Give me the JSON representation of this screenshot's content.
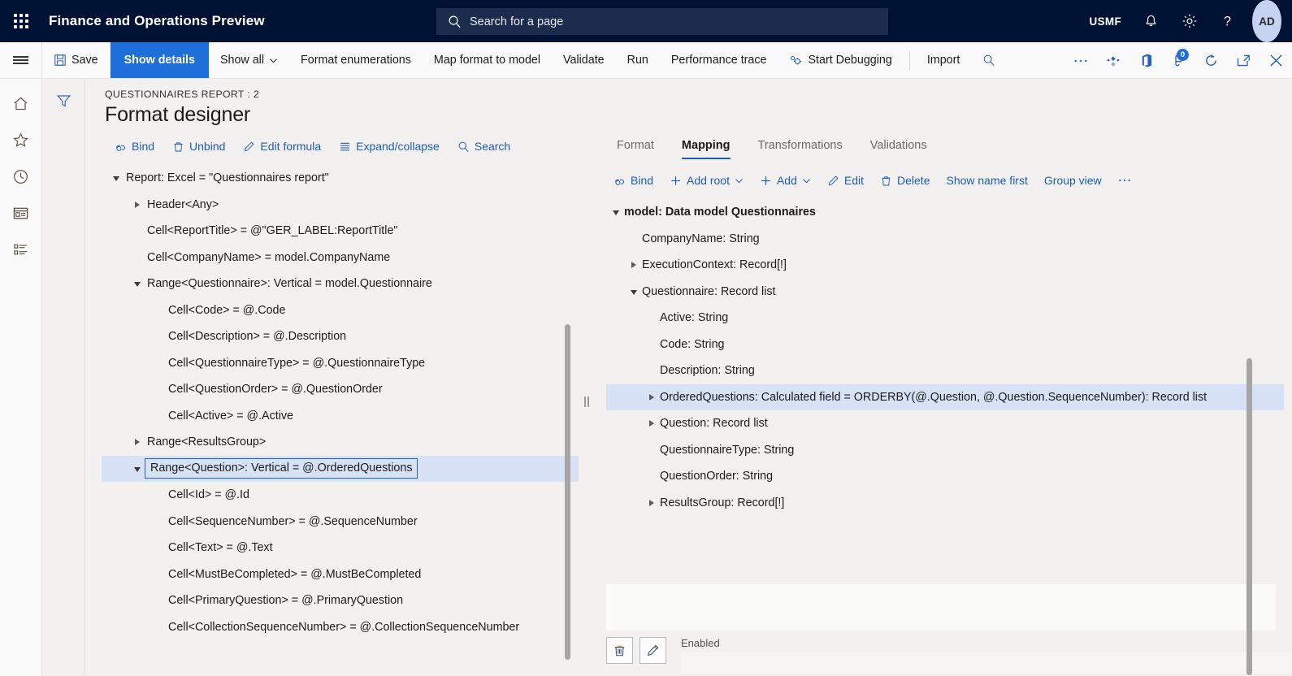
{
  "header": {
    "app_title": "Finance and Operations Preview",
    "search_placeholder": "Search for a page",
    "company": "USMF",
    "avatar_initials": "AD",
    "icons": [
      "waffle-icon",
      "search-icon",
      "bell-icon",
      "gear-icon",
      "help-icon"
    ]
  },
  "command_bar": {
    "save_label": "Save",
    "show_details_label": "Show details",
    "show_all_label": "Show all",
    "format_enumerations_label": "Format enumerations",
    "map_format_to_model_label": "Map format to model",
    "validate_label": "Validate",
    "run_label": "Run",
    "performance_trace_label": "Performance trace",
    "start_debugging_label": "Start Debugging",
    "import_label": "Import",
    "notification_count": "0"
  },
  "page": {
    "breadcrumb": "QUESTIONNAIRES REPORT : 2",
    "title": "Format designer"
  },
  "format_toolbar": [
    {
      "label": "Bind",
      "icon": "bind-icon"
    },
    {
      "label": "Unbind",
      "icon": "trash-icon"
    },
    {
      "label": "Edit formula",
      "icon": "pencil-icon"
    },
    {
      "label": "Expand/collapse",
      "icon": "list-icon"
    },
    {
      "label": "Search",
      "icon": "search-icon"
    }
  ],
  "format_tree": [
    {
      "label": "Report: Excel = \"Questionnaires report\"",
      "indent": 0,
      "twisty": "open",
      "selected": false
    },
    {
      "label": "Header<Any>",
      "indent": 1,
      "twisty": "closed",
      "selected": false
    },
    {
      "label": "Cell<ReportTitle> = @\"GER_LABEL:ReportTitle\"",
      "indent": 1,
      "twisty": "none",
      "selected": false
    },
    {
      "label": "Cell<CompanyName> = model.CompanyName",
      "indent": 1,
      "twisty": "none",
      "selected": false
    },
    {
      "label": "Range<Questionnaire>: Vertical = model.Questionnaire",
      "indent": 1,
      "twisty": "open",
      "selected": false
    },
    {
      "label": "Cell<Code> = @.Code",
      "indent": 2,
      "twisty": "none",
      "selected": false
    },
    {
      "label": "Cell<Description> = @.Description",
      "indent": 2,
      "twisty": "none",
      "selected": false
    },
    {
      "label": "Cell<QuestionnaireType> = @.QuestionnaireType",
      "indent": 2,
      "twisty": "none",
      "selected": false
    },
    {
      "label": "Cell<QuestionOrder> = @.QuestionOrder",
      "indent": 2,
      "twisty": "none",
      "selected": false
    },
    {
      "label": "Cell<Active> = @.Active",
      "indent": 2,
      "twisty": "none",
      "selected": false
    },
    {
      "label": "Range<ResultsGroup>",
      "indent": 1,
      "twisty": "closed",
      "selected": false
    },
    {
      "label": "Range<Question>: Vertical = @.OrderedQuestions",
      "indent": 1,
      "twisty": "open",
      "selected": true
    },
    {
      "label": "Cell<Id> = @.Id",
      "indent": 2,
      "twisty": "none",
      "selected": false
    },
    {
      "label": "Cell<SequenceNumber> = @.SequenceNumber",
      "indent": 2,
      "twisty": "none",
      "selected": false
    },
    {
      "label": "Cell<Text> = @.Text",
      "indent": 2,
      "twisty": "none",
      "selected": false
    },
    {
      "label": "Cell<MustBeCompleted> = @.MustBeCompleted",
      "indent": 2,
      "twisty": "none",
      "selected": false
    },
    {
      "label": "Cell<PrimaryQuestion> = @.PrimaryQuestion",
      "indent": 2,
      "twisty": "none",
      "selected": false
    },
    {
      "label": "Cell<CollectionSequenceNumber> = @.CollectionSequenceNumber",
      "indent": 2,
      "twisty": "none",
      "selected": false
    }
  ],
  "tabs": [
    {
      "label": "Format",
      "active": false
    },
    {
      "label": "Mapping",
      "active": true
    },
    {
      "label": "Transformations",
      "active": false
    },
    {
      "label": "Validations",
      "active": false
    }
  ],
  "mapping_toolbar": [
    {
      "label": "Bind",
      "icon": "bind-icon",
      "caret": false
    },
    {
      "label": "Add root",
      "icon": "plus-icon",
      "caret": true
    },
    {
      "label": "Add",
      "icon": "plus-icon",
      "caret": true
    },
    {
      "label": "Edit",
      "icon": "pencil-icon",
      "caret": false
    },
    {
      "label": "Delete",
      "icon": "trash-icon",
      "caret": false
    },
    {
      "label": "Show name first",
      "icon": "none",
      "caret": false
    },
    {
      "label": "Group view",
      "icon": "none",
      "caret": false
    },
    {
      "label": "…",
      "icon": "overflow-icon",
      "caret": false
    }
  ],
  "model_tree": [
    {
      "label": "model: Data model Questionnaires",
      "indent": 0,
      "twisty": "open",
      "selected": false,
      "bold": true
    },
    {
      "label": "CompanyName: String",
      "indent": 1,
      "twisty": "none",
      "selected": false,
      "bold": false
    },
    {
      "label": "ExecutionContext: Record[!]",
      "indent": 1,
      "twisty": "closed",
      "selected": false,
      "bold": false
    },
    {
      "label": "Questionnaire: Record list",
      "indent": 1,
      "twisty": "open",
      "selected": false,
      "bold": false
    },
    {
      "label": "Active: String",
      "indent": 2,
      "twisty": "none",
      "selected": false,
      "bold": false
    },
    {
      "label": "Code: String",
      "indent": 2,
      "twisty": "none",
      "selected": false,
      "bold": false
    },
    {
      "label": "Description: String",
      "indent": 2,
      "twisty": "none",
      "selected": false,
      "bold": false
    },
    {
      "label": "OrderedQuestions: Calculated field = ORDERBY(@.Question, @.Question.SequenceNumber): Record list",
      "indent": 2,
      "twisty": "closed",
      "selected": true,
      "bold": false
    },
    {
      "label": "Question: Record list",
      "indent": 2,
      "twisty": "closed",
      "selected": false,
      "bold": false
    },
    {
      "label": "QuestionnaireType: String",
      "indent": 2,
      "twisty": "none",
      "selected": false,
      "bold": false
    },
    {
      "label": "QuestionOrder: String",
      "indent": 2,
      "twisty": "none",
      "selected": false,
      "bold": false
    },
    {
      "label": "ResultsGroup: Record[!]",
      "indent": 2,
      "twisty": "closed",
      "selected": false,
      "bold": false
    }
  ],
  "bottom": {
    "delete_icon": "trash-icon",
    "edit_icon": "pencil-icon",
    "enabled_label": "Enabled",
    "enabled_value": ""
  },
  "colors": {
    "nav_bg": "#001233",
    "accent": "#1e6fd9",
    "link": "#1e5bb8",
    "selection": "#d8e2f7",
    "selection_border": "#2564cf",
    "page_bg": "#f2f1f0"
  }
}
